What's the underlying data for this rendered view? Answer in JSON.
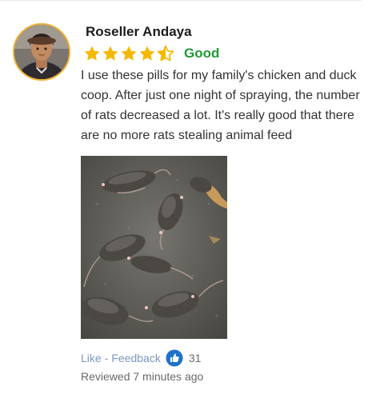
{
  "review": {
    "reviewer_name": "Roseller Andaya",
    "rating": 4.5,
    "rating_max": 5,
    "rating_label": "Good",
    "text": "I use these pills for my family's chicken and duck coop. After just one night of spraying, the number of rats decreased a lot. It's really good that there are no more rats stealing animal feed",
    "actions": {
      "like_label": "Like",
      "separator": "-",
      "feedback_label": "Feedback",
      "like_count": "31"
    },
    "timestamp": "Reviewed 7 minutes ago"
  },
  "icons": {
    "star": "star-icon",
    "half_star": "half-star-icon",
    "thumbs_up": "thumbs-up-icon"
  },
  "colors": {
    "star": "#f5b800",
    "rating_label": "#1f9a35",
    "link": "#7b97bf",
    "thumb_badge": "#1f72c8",
    "avatar_border": "#f2b233"
  }
}
